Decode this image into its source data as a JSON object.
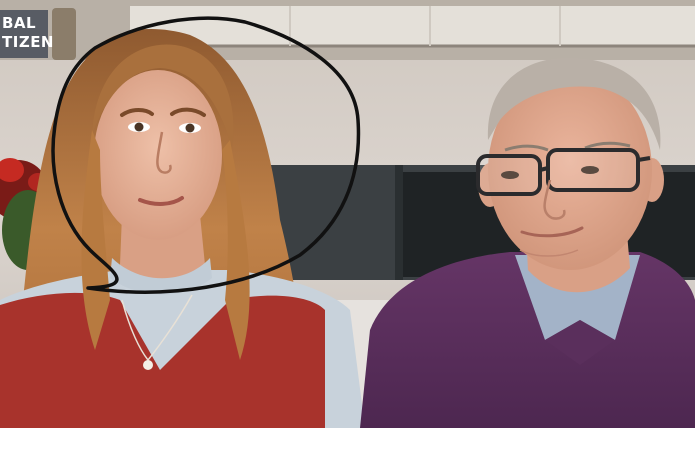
{
  "image": {
    "description_labels": {
      "logo_line_1": "BAL",
      "logo_line_2": "TIZEN"
    },
    "colors": {
      "wall": "#d8d2cc",
      "shelf": "#b9b2aa",
      "fireplace": "#3a3f42",
      "left_sweater": "#a8332c",
      "left_shirt": "#c9d3dc",
      "right_sweater": "#5a2f5c",
      "right_shirt": "#9fb0c6",
      "hair_left": "#b9773f",
      "hair_right": "#b8b0a8",
      "skin": "#e3ad94",
      "circle_ink": "#111111"
    },
    "annotation": "hand-drawn-circle-icon"
  }
}
